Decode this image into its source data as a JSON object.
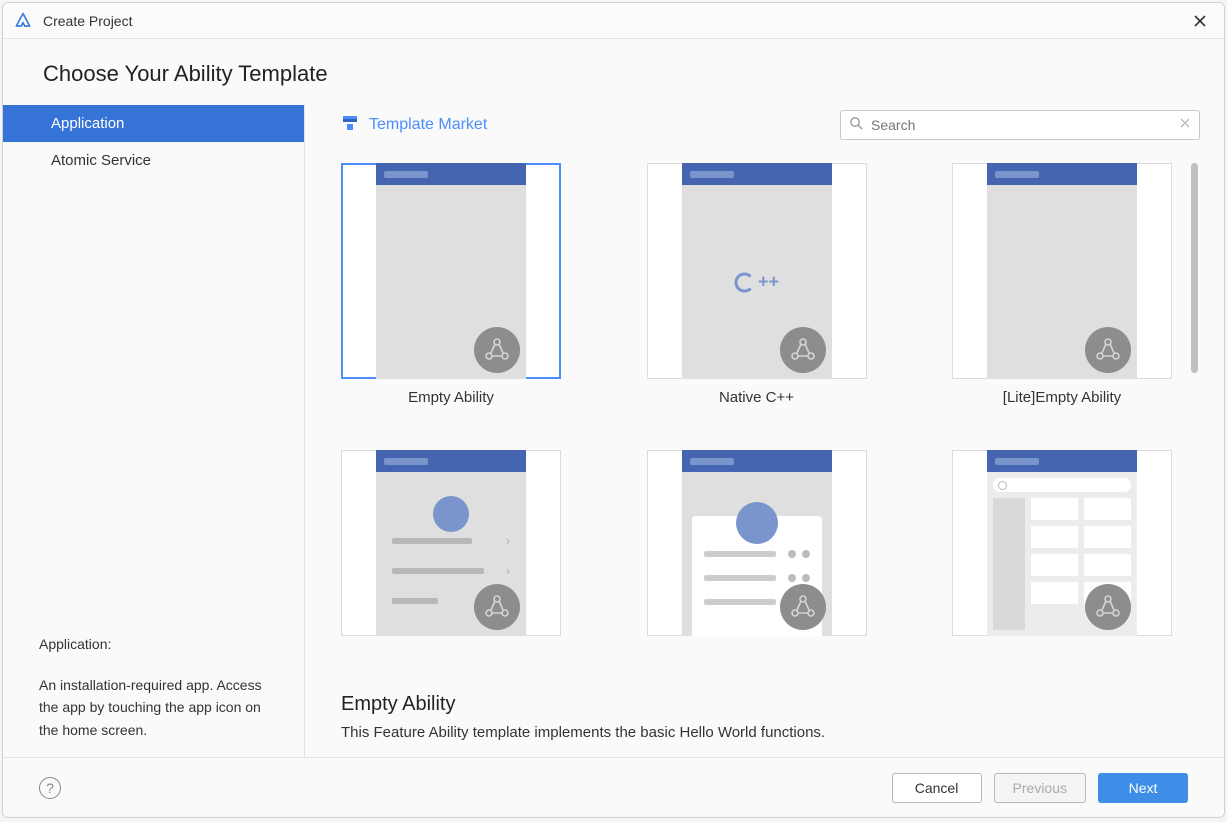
{
  "window": {
    "title": "Create Project"
  },
  "heading": "Choose Your Ability Template",
  "sidebar": {
    "items": [
      {
        "label": "Application",
        "active": true
      },
      {
        "label": "Atomic Service",
        "active": false
      }
    ],
    "descTitle": "Application:",
    "descBody": "An installation-required app. Access the app by touching the app icon on the home screen."
  },
  "market": {
    "label": "Template Market"
  },
  "search": {
    "placeholder": "Search"
  },
  "templates": [
    {
      "label": "Empty Ability",
      "selected": true
    },
    {
      "label": "Native C++",
      "selected": false
    },
    {
      "label": "[Lite]Empty Ability",
      "selected": false
    },
    {
      "label": "",
      "selected": false
    },
    {
      "label": "",
      "selected": false
    },
    {
      "label": "",
      "selected": false
    }
  ],
  "detail": {
    "title": "Empty Ability",
    "desc": "This Feature Ability template implements the basic Hello World functions."
  },
  "footer": {
    "cancel": "Cancel",
    "previous": "Previous",
    "next": "Next"
  },
  "cpp_text": "++"
}
